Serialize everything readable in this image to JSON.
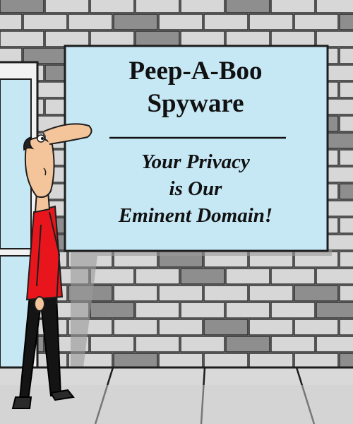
{
  "sign": {
    "title_line1": "Peep-A-Boo",
    "title_line2": "Spyware",
    "tagline_line1": "Your Privacy",
    "tagline_line2": "is Our",
    "tagline_line3": "Eminent Domain!"
  },
  "colors": {
    "sign_background": "#c6e8f5",
    "brick_light": "#d7d7d7",
    "brick_dark": "#8e8e8e",
    "mortar": "#2a2a2a",
    "shirt": "#e8161c",
    "skin": "#f4c49a",
    "window_glass": "#c6e8f5",
    "sidewalk": "#d9d9d9"
  }
}
